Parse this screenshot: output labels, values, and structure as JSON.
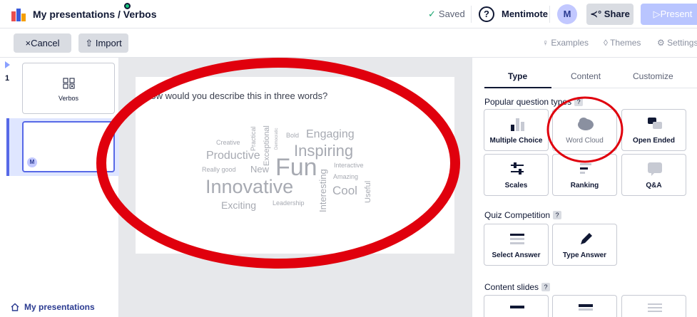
{
  "header": {
    "breadcrumb": "My presentations / Verbos",
    "saved": "Saved",
    "help": "?",
    "mentimote": "Mentimote",
    "avatar": "M",
    "share": "Share",
    "present": "Present"
  },
  "toolbar": {
    "cancel": "Cancel",
    "import": "Import",
    "examples": "Examples",
    "themes": "Themes",
    "settings": "Settings"
  },
  "slides": {
    "number": "1",
    "first_label": "Verbos",
    "second_avatar": "M",
    "my_presentations": "My presentations"
  },
  "slide": {
    "question": "How would you describe this in three words?",
    "words": [
      "Creative",
      "Practical",
      "Exceptional",
      "Democratic",
      "Bold",
      "Engaging",
      "Productive",
      "Inspiring",
      "Really good",
      "New",
      "Fun",
      "Interactive",
      "Amazing",
      "Innovative",
      "Interesting",
      "Cool",
      "Useful",
      "Exciting",
      "Leadership"
    ]
  },
  "panel": {
    "tabs": [
      "Type",
      "Content",
      "Customize"
    ],
    "popular_heading": "Popular question types",
    "popular_types": [
      "Multiple Choice",
      "Word Cloud",
      "Open Ended",
      "Scales",
      "Ranking",
      "Q&A"
    ],
    "quiz_heading": "Quiz Competition",
    "quiz_types": [
      "Select Answer",
      "Type Answer"
    ],
    "content_heading": "Content slides",
    "help_mark": "?"
  },
  "colors": {
    "accent": "#5769e7",
    "annotation": "#e0000d",
    "word_cloud": "#a7aab2",
    "selected_slide": "#dfe6ff"
  }
}
